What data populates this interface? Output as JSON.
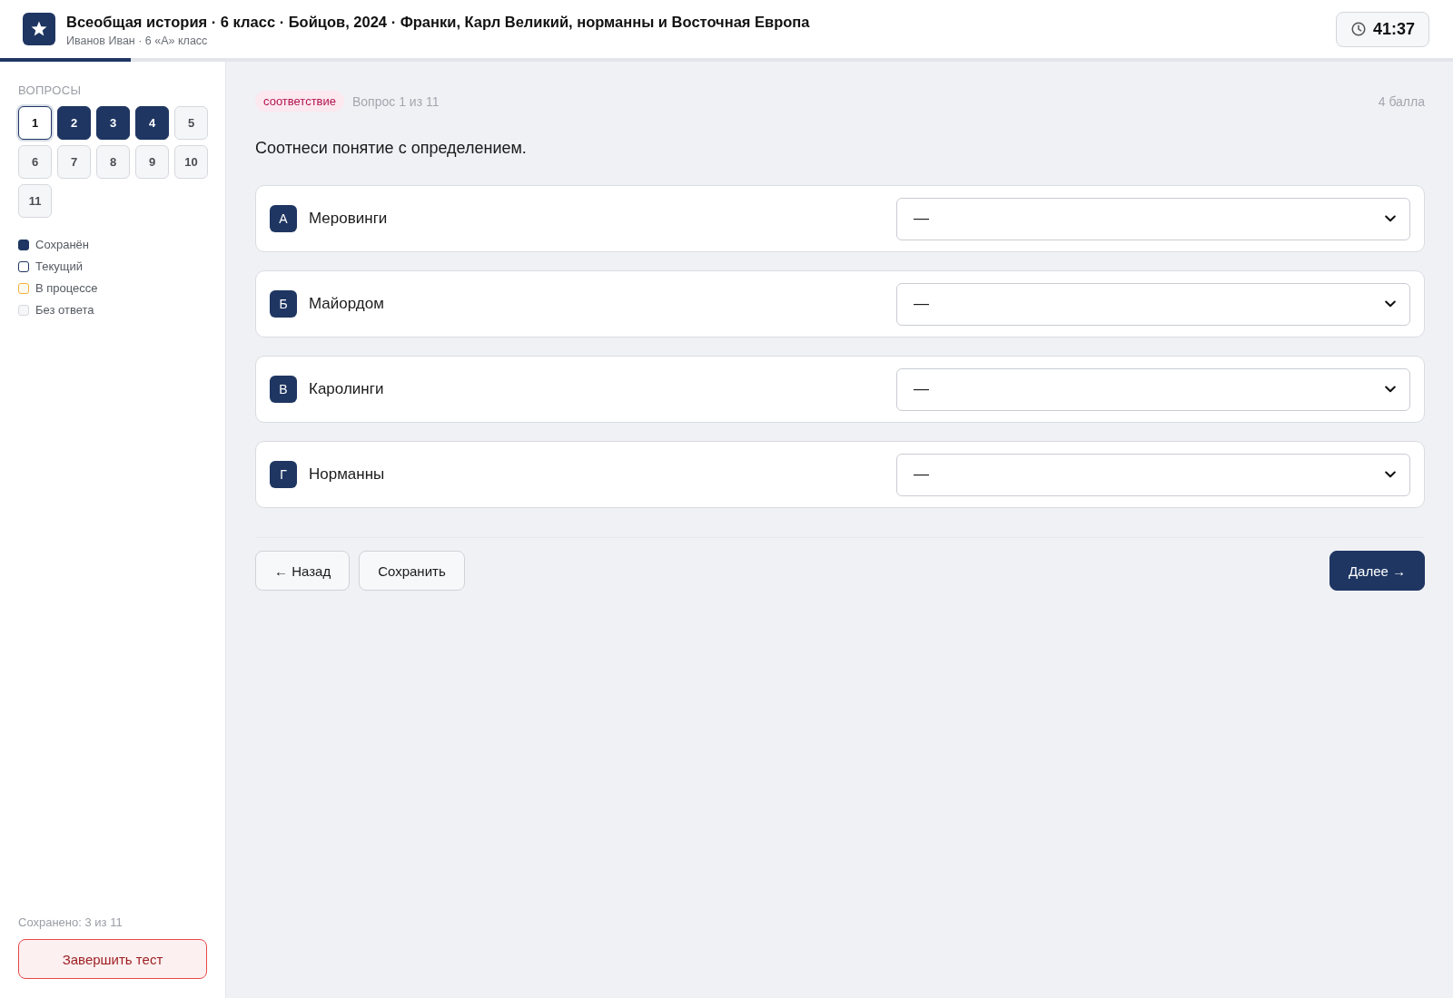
{
  "header": {
    "title": "Всеобщая история · 6 класс · Бойцов, 2024 · Франки, Карл Великий, норманны и Восточная Европа",
    "subtitle": "Иванов Иван · 6 «А» класс",
    "timer": "41:37"
  },
  "progress": {
    "level": 0.09
  },
  "sidebar": {
    "heading": "ВОПРОСЫ",
    "questions": [
      {
        "label": "1",
        "selected": true,
        "kind": "unanswered"
      },
      {
        "label": "2",
        "selected": false,
        "kind": "saved"
      },
      {
        "label": "3",
        "selected": false,
        "kind": "saved"
      },
      {
        "label": "4",
        "selected": false,
        "kind": "saved"
      },
      {
        "label": "5",
        "selected": false,
        "kind": "unanswered"
      },
      {
        "label": "6",
        "selected": false,
        "kind": "unanswered"
      },
      {
        "label": "7",
        "selected": false,
        "kind": "unanswered"
      },
      {
        "label": "8",
        "selected": false,
        "kind": "unanswered"
      },
      {
        "label": "9",
        "selected": false,
        "kind": "unanswered"
      },
      {
        "label": "10",
        "selected": false,
        "kind": "unanswered"
      },
      {
        "label": "11",
        "selected": false,
        "kind": "unanswered"
      }
    ],
    "legend": [
      {
        "kind": "saved",
        "label": "Сохранён"
      },
      {
        "kind": "current",
        "label": "Текущий"
      },
      {
        "kind": "in_progress",
        "label": "В процессе"
      },
      {
        "kind": "unanswered",
        "label": "Без ответа"
      }
    ],
    "saved_count": "Сохранено: 3 из 11",
    "finish_button": "Завершить тест"
  },
  "question": {
    "type_tag": "соответствие",
    "counter": "Вопрос 1 из 11",
    "points": "4 балла",
    "prompt": "Соотнеси понятие с определением.",
    "pairs": [
      {
        "letter": "А",
        "term": "Меровинги",
        "answer": "—"
      },
      {
        "letter": "Б",
        "term": "Майордом",
        "answer": "—"
      },
      {
        "letter": "В",
        "term": "Каролинги",
        "answer": "—"
      },
      {
        "letter": "Г",
        "term": "Норманны",
        "answer": "—"
      }
    ]
  },
  "navigation": {
    "back": "← Назад",
    "save": "Сохранить",
    "next": "Далее →"
  }
}
